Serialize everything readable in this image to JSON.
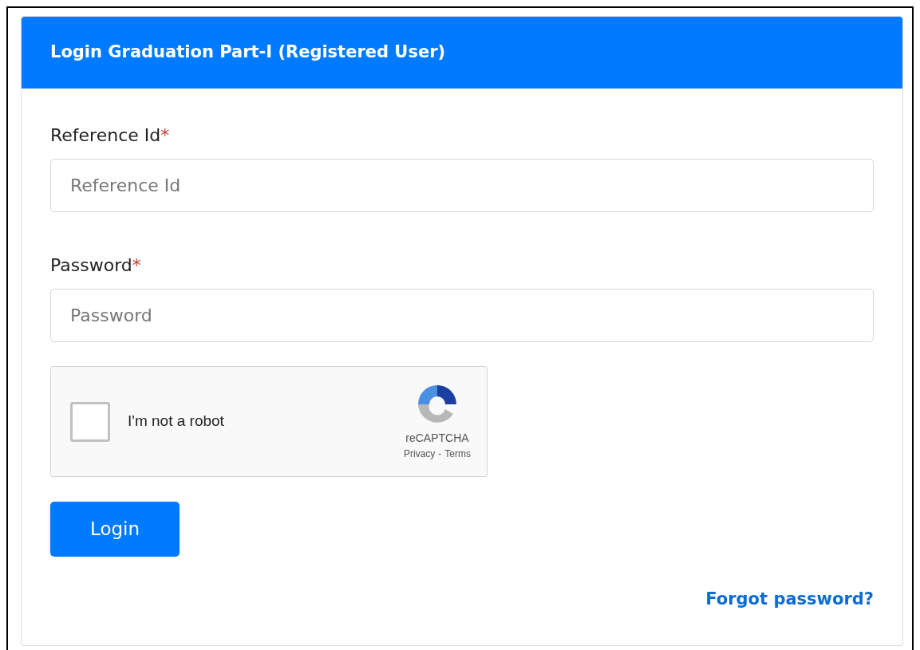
{
  "card": {
    "title": "Login Graduation Part-I (Registered User)"
  },
  "fields": [
    {
      "label": "Reference Id",
      "required_mark": "*",
      "placeholder": "Reference Id"
    },
    {
      "label": "Password",
      "required_mark": "*",
      "placeholder": "Password"
    }
  ],
  "captcha": {
    "label": "I'm not a robot",
    "checked": false,
    "brand": "reCAPTCHA",
    "privacy": "Privacy",
    "separator": "-",
    "terms": "Terms"
  },
  "login_button": "Login",
  "forgot_link": "Forgot password?"
}
